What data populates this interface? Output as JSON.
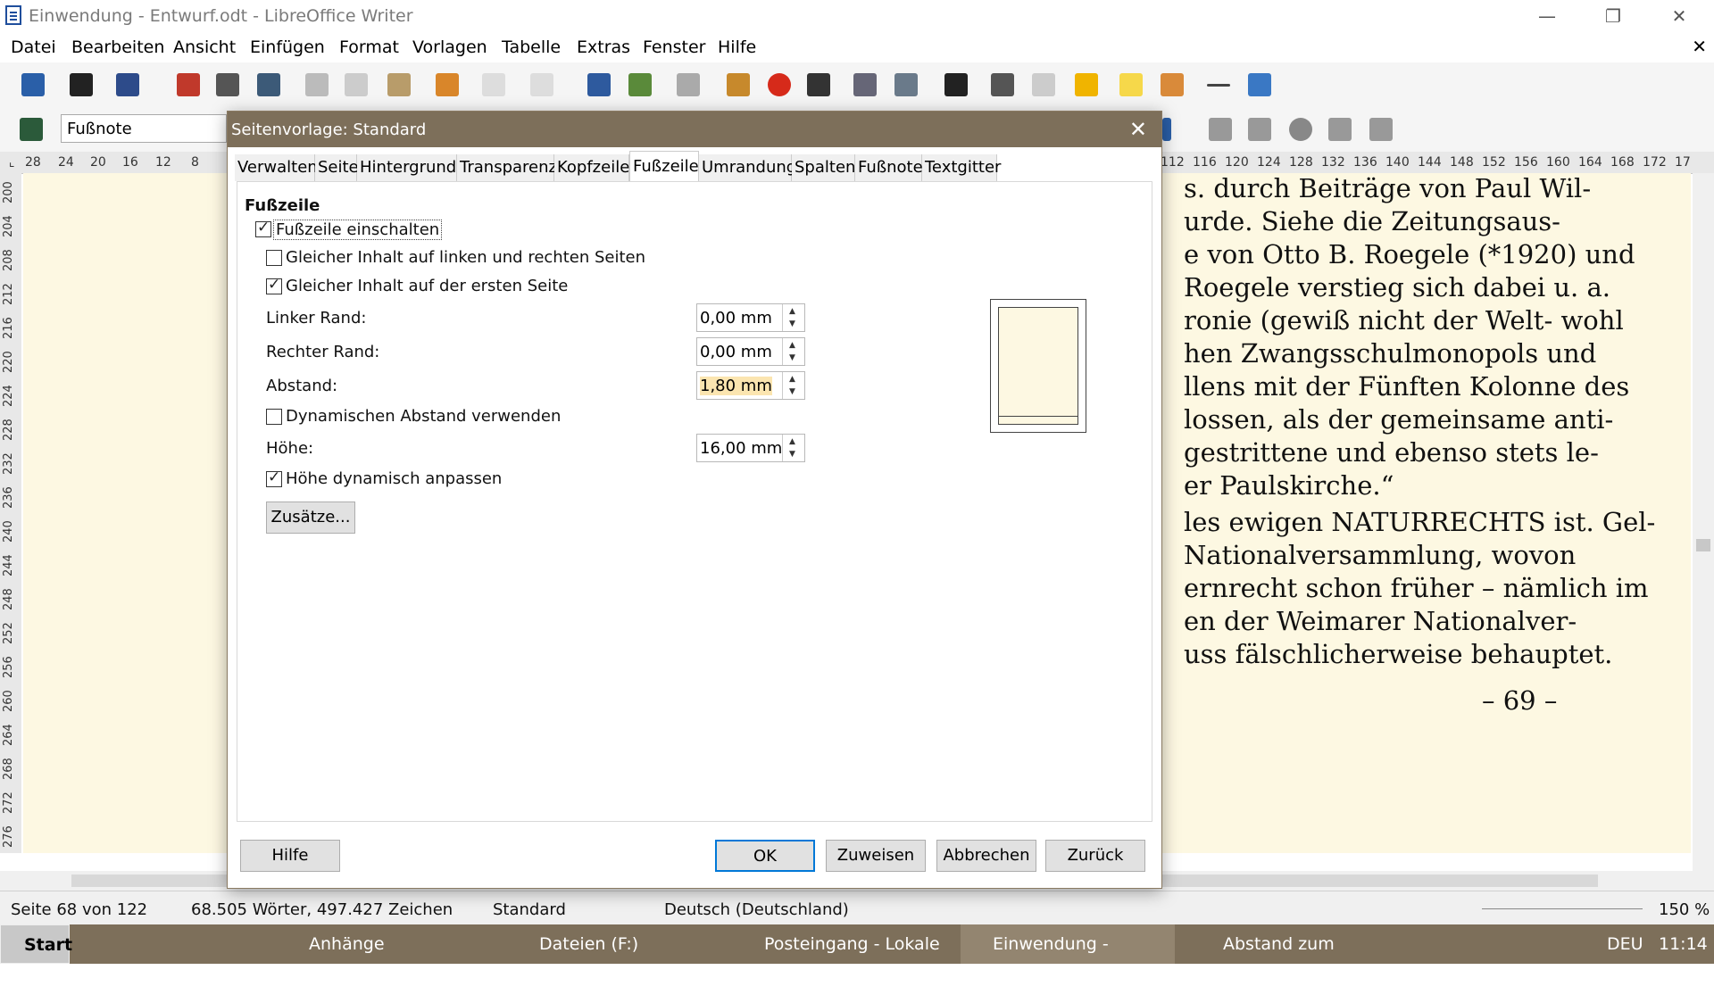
{
  "window": {
    "title": "Einwendung - Entwurf.odt - LibreOffice Writer",
    "minimize_glyph": "—",
    "restore_glyph": "❐",
    "close_glyph": "✕"
  },
  "menu": {
    "items": [
      "Datei",
      "Bearbeiten",
      "Ansicht",
      "Einfügen",
      "Format",
      "Vorlagen",
      "Tabelle",
      "Extras",
      "Fenster",
      "Hilfe"
    ],
    "close_glyph": "✕"
  },
  "toolbar": {
    "paragraph_style": "Fußnote",
    "icons": [
      "new-document-icon",
      "open-icon",
      "save-icon",
      "export-pdf-icon",
      "print-icon",
      "print-preview-icon",
      "cut-icon",
      "copy-icon",
      "paste-icon",
      "clone-format-icon",
      "undo-icon",
      "redo-icon",
      "find-replace-icon",
      "spellcheck-icon",
      "table-icon",
      "image-icon",
      "chart-icon",
      "textbox-icon",
      "page-break-icon",
      "field-icon",
      "special-character-icon",
      "hyperlink-icon",
      "footnote-icon",
      "bookmark-icon",
      "comment-icon",
      "track-changes-icon",
      "line-icon",
      "basic-shapes-icon"
    ]
  },
  "ruler": {
    "h_left": [
      "28",
      "24",
      "20",
      "16",
      "12",
      "8"
    ],
    "h_right": [
      "112",
      "116",
      "120",
      "124",
      "128",
      "132",
      "136",
      "140",
      "144",
      "148",
      "152",
      "156",
      "160",
      "164",
      "168",
      "172",
      "17"
    ],
    "v": [
      "200",
      "204",
      "208",
      "212",
      "216",
      "220",
      "224",
      "228",
      "232",
      "236",
      "240",
      "244",
      "248",
      "252",
      "256",
      "260",
      "264",
      "268",
      "272",
      "276"
    ]
  },
  "document": {
    "lines": [
      "s. durch Beiträge von Paul Wil-",
      "urde. Siehe die Zeitungsaus-",
      "e von Otto B. Roegele (*1920) und",
      " Roegele verstieg sich dabei u. a.",
      "ronie (gewiß nicht der Welt- wohl",
      "hen Zwangsschulmonopols und",
      "llens mit der Fünften Kolonne des",
      "lossen, als der gemeinsame anti-",
      "gestrittene und ebenso stets le-",
      "er Paulskirche.“",
      "les ewigen NATURRECHTS ist. Gel-",
      " Nationalversammlung, wovon",
      "ernrecht schon früher – nämlich im",
      "en der Weimarer Nationalver-",
      "uss fälschlicherweise behauptet."
    ],
    "page_number": "– 69 –"
  },
  "dialog": {
    "title": "Seitenvorlage: Standard",
    "close_glyph": "✕",
    "tabs": [
      "Verwalten",
      "Seite",
      "Hintergrund",
      "Transparenz",
      "Kopfzeile",
      "Fußzeile",
      "Umrandung",
      "Spalten",
      "Fußnote",
      "Textgitter"
    ],
    "active_tab": "Fußzeile",
    "section_title": "Fußzeile",
    "enable_footer": {
      "label": "Fußzeile einschalten",
      "checked": true
    },
    "same_left_right": {
      "label": "Gleicher Inhalt auf linken und rechten Seiten",
      "checked": false
    },
    "same_first_page": {
      "label": "Gleicher Inhalt auf der ersten Seite",
      "checked": true
    },
    "left_margin": {
      "label": "Linker Rand:",
      "value": "0,00 mm"
    },
    "right_margin": {
      "label": "Rechter Rand:",
      "value": "0,00 mm"
    },
    "spacing": {
      "label": "Abstand:",
      "value": "1,80 mm"
    },
    "dynamic_spacing": {
      "label": "Dynamischen Abstand verwenden",
      "checked": false
    },
    "height": {
      "label": "Höhe:",
      "value": "16,00 mm"
    },
    "autofit_height": {
      "label": "Höhe dynamisch anpassen",
      "checked": true
    },
    "more_button": "Zusätze...",
    "buttons": {
      "help": "Hilfe",
      "ok": "OK",
      "apply": "Zuweisen",
      "cancel": "Abbrechen",
      "reset": "Zurück"
    }
  },
  "status": {
    "page": "Seite 68 von 122",
    "words": "68.505 Wörter, 497.427 Zeichen",
    "page_style": "Standard",
    "language": "Deutsch (Deutschland)",
    "zoom": "150 %"
  },
  "taskbar": {
    "start": "Start",
    "tasks": [
      "Anhänge",
      "Dateien (F:)",
      "Posteingang - Lokale ...",
      "Einwendung - Entwurf...",
      "Abstand zum Hauptte..."
    ],
    "tray_lang": "DEU",
    "clock": "11:14"
  },
  "colors": {
    "accent": "#0078d7",
    "dialog_title_bg": "#7d6f5a",
    "page_bg": "#fdf8e2",
    "highlight": "#fbe5b0"
  }
}
